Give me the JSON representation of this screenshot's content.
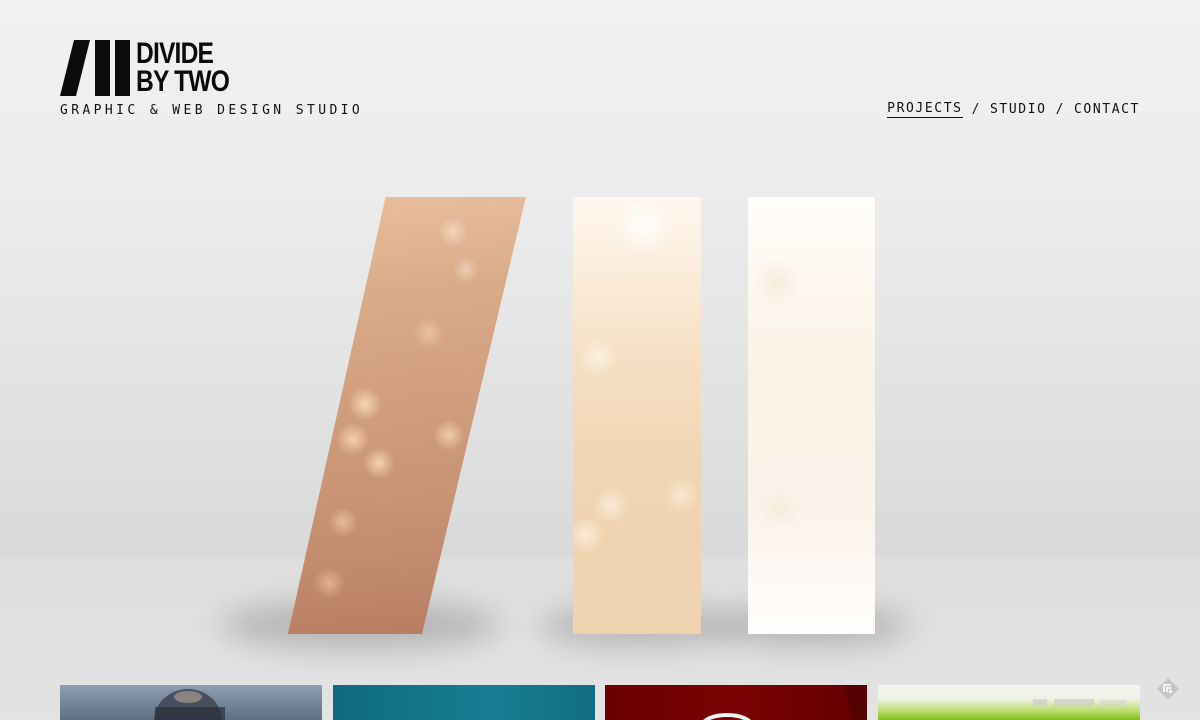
{
  "brand": {
    "name_line1": "DIVIDE",
    "name_line2": "BY TWO",
    "tagline": "GRAPHIC & WEB DESIGN STUDIO"
  },
  "nav": {
    "items": [
      {
        "label": "PROJECTS",
        "active": true
      },
      {
        "label": "STUDIO",
        "active": false
      },
      {
        "label": "CONTACT",
        "active": false
      }
    ],
    "separator": "/"
  },
  "hero": {
    "image": "divide-by-two-logo-bars-with-bokeh"
  },
  "projects": {
    "thumbnails": [
      {
        "name": "portrait-project",
        "color": "#7a8ba0"
      },
      {
        "name": "teal-project",
        "color": "#157a8f"
      },
      {
        "name": "red-project",
        "color": "#700000"
      },
      {
        "name": "green-project",
        "color": "#8cc63f"
      }
    ]
  },
  "footer": {
    "icon": "feed-icon"
  }
}
